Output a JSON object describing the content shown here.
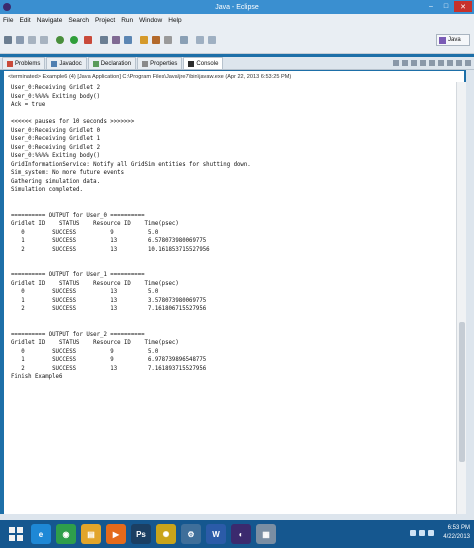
{
  "window": {
    "title": "Java - Eclipse"
  },
  "menu": [
    "File",
    "Edit",
    "Navigate",
    "Search",
    "Project",
    "Run",
    "Window",
    "Help"
  ],
  "perspective": {
    "label": "Java"
  },
  "views": {
    "tabs": [
      {
        "label": "Problems",
        "icon": "problems-icon",
        "active": false
      },
      {
        "label": "Javadoc",
        "icon": "javadoc-icon",
        "active": false
      },
      {
        "label": "Declaration",
        "icon": "declaration-icon",
        "active": false
      },
      {
        "label": "Properties",
        "icon": "properties-icon",
        "active": false
      },
      {
        "label": "Console",
        "icon": "console-icon",
        "active": true
      }
    ]
  },
  "console": {
    "header": "<terminated> Example6 (4) [Java Application] C:\\Program Files\\Java\\jre7\\bin\\javaw.exe (Apr 22, 2013 6:53:25 PM)",
    "lines": [
      "User_0:Receiving Gridlet 2",
      "User_0:%%%% Exiting body()",
      "Ack = true",
      "",
      "<<<<<< pauses for 10 seconds >>>>>>>",
      "User_0:Receiving Gridlet 0",
      "User_0:Receiving Gridlet 1",
      "User_0:Receiving Gridlet 2",
      "User_0:%%%% Exiting body()",
      "GridInformationService: Notify all GridSim entities for shutting down.",
      "Sim_system: No more future events",
      "Gathering simulation data.",
      "Simulation completed.",
      "",
      "",
      "========== OUTPUT for User_0 ==========",
      "Gridlet ID    STATUS    Resource ID    Time(psec)",
      "   0        SUCCESS          9          5.0",
      "   1        SUCCESS          13         6.578073980069775",
      "   2        SUCCESS          13         10.161853715527956",
      "",
      "",
      "========== OUTPUT for User_1 ==========",
      "Gridlet ID    STATUS    Resource ID    Time(psec)",
      "   0        SUCCESS          13         5.0",
      "   1        SUCCESS          13         3.578073980069775",
      "   2        SUCCESS          13         7.161806715527956",
      "",
      "",
      "========== OUTPUT for User_2 ==========",
      "Gridlet ID    STATUS    Resource ID    Time(psec)",
      "   0        SUCCESS          9          5.0",
      "   1        SUCCESS          9          6.978739896548775",
      "   2        SUCCESS          13         7.161893715527956",
      "Finish Example6"
    ]
  },
  "taskbar": {
    "apps": [
      {
        "name": "internet-explorer-icon",
        "glyph": "e",
        "color": "#1e88d6"
      },
      {
        "name": "chrome-icon",
        "glyph": "◉",
        "color": "#2e9e4b"
      },
      {
        "name": "explorer-icon",
        "glyph": "▤",
        "color": "#e2a52b"
      },
      {
        "name": "media-player-icon",
        "glyph": "▶",
        "color": "#e46a1b"
      },
      {
        "name": "photoshop-icon",
        "glyph": "Ps",
        "color": "#1b3f63"
      },
      {
        "name": "sun-app-icon",
        "glyph": "✺",
        "color": "#c9a41b"
      },
      {
        "name": "network-icon",
        "glyph": "⚙",
        "color": "#3f6f9a"
      },
      {
        "name": "word-icon",
        "glyph": "W",
        "color": "#2b5ba8"
      },
      {
        "name": "eclipse-icon",
        "glyph": "◐",
        "color": "#3b2a6e"
      },
      {
        "name": "document-icon",
        "glyph": "▦",
        "color": "#7a8ea3"
      }
    ],
    "time": "6:53 PM",
    "date": "4/22/2013"
  },
  "colors": {
    "taskbar": "#15578f",
    "titlebar": "#3a8fd0"
  }
}
